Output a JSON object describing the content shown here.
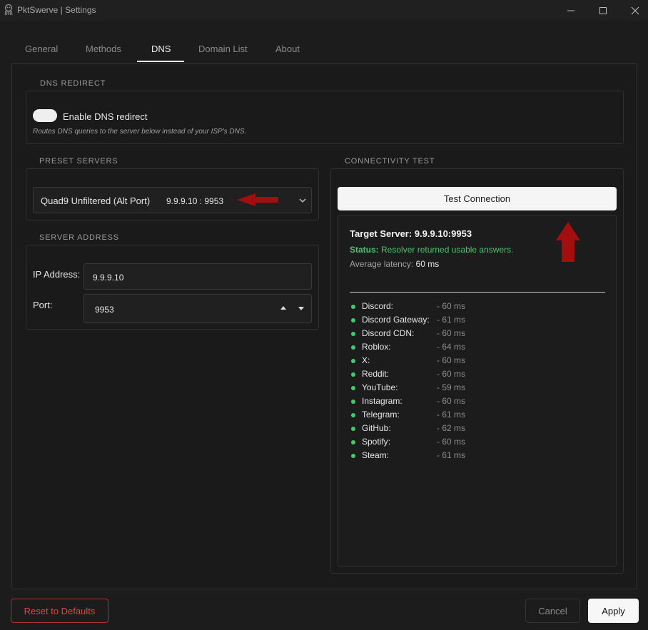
{
  "window": {
    "title": "PktSwerve | Settings"
  },
  "tabs": [
    {
      "label": "General"
    },
    {
      "label": "Methods"
    },
    {
      "label": "DNS"
    },
    {
      "label": "Domain List"
    },
    {
      "label": "About"
    }
  ],
  "active_tab": "DNS",
  "dns_redirect": {
    "group_label": "DNS REDIRECT",
    "toggle_label": "Enable DNS redirect",
    "toggle_state": "on",
    "description": "Routes DNS queries to the server below instead of your ISP's DNS."
  },
  "preset_servers": {
    "group_label": "PRESET SERVERS",
    "selected_name": "Quad9 Unfiltered (Alt Port)",
    "selected_address": "9.9.9.10 : 9953"
  },
  "server_address": {
    "group_label": "SERVER ADDRESS",
    "ip_label": "IP Address:",
    "ip_value": "9.9.9.10",
    "port_label": "Port:",
    "port_value": "9953"
  },
  "connectivity": {
    "group_label": "CONNECTIVITY TEST",
    "test_button": "Test Connection",
    "target_label": "Target Server:",
    "target_value": "9.9.9.10:9953",
    "status_label": "Status:",
    "status_value": "Resolver returned usable answers.",
    "latency_label": "Average latency:",
    "latency_value": "60 ms",
    "results": [
      {
        "name": "Discord:",
        "ms": "- 60 ms"
      },
      {
        "name": "Discord Gateway:",
        "ms": "- 61 ms"
      },
      {
        "name": "Discord CDN:",
        "ms": "- 60 ms"
      },
      {
        "name": "Roblox:",
        "ms": "- 64 ms"
      },
      {
        "name": "X:",
        "ms": "- 60 ms"
      },
      {
        "name": "Reddit:",
        "ms": "- 60 ms"
      },
      {
        "name": "YouTube:",
        "ms": "- 59 ms"
      },
      {
        "name": "Instagram:",
        "ms": "- 60 ms"
      },
      {
        "name": "Telegram:",
        "ms": "- 61 ms"
      },
      {
        "name": "GitHub:",
        "ms": "- 62 ms"
      },
      {
        "name": "Spotify:",
        "ms": "- 60 ms"
      },
      {
        "name": "Steam:",
        "ms": "- 61 ms"
      }
    ]
  },
  "footer": {
    "reset_label": "Reset to Defaults",
    "cancel_label": "Cancel",
    "apply_label": "Apply"
  },
  "colors": {
    "accent_red": "#a30e0e",
    "status_green": "#49c46a",
    "danger": "#e04545"
  },
  "icons": [
    "app-logo-icon",
    "minimize-icon",
    "maximize-icon",
    "close-icon",
    "chevron-down-icon",
    "spin-up-icon",
    "spin-down-icon",
    "arrow-left-annotation",
    "arrow-up-annotation"
  ]
}
